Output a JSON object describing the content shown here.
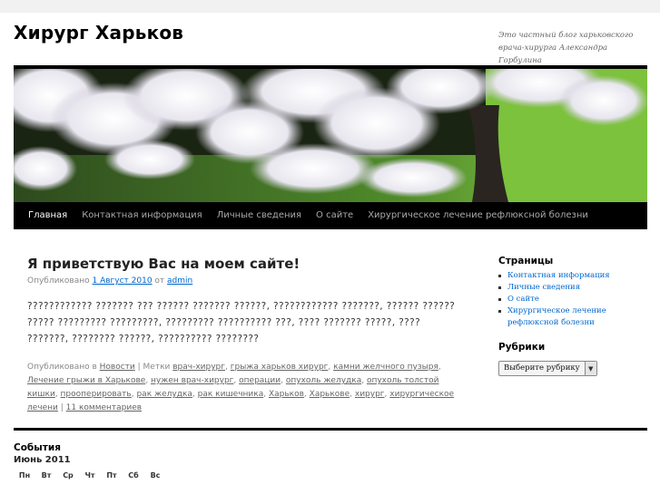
{
  "site": {
    "title": "Хирург Харьков",
    "description": "Это частный блог харьковского врача-хирурга Александра Горбулина"
  },
  "nav": {
    "items": [
      {
        "label": "Главная",
        "active": true
      },
      {
        "label": "Контактная информация"
      },
      {
        "label": "Личные сведения"
      },
      {
        "label": "О сайте"
      },
      {
        "label": "Хирургическое лечение рефлюксной болезни"
      }
    ]
  },
  "post": {
    "title": "Я приветствую  Вас на моем сайте!",
    "meta_prefix": "Опубликовано",
    "date": "1 Август 2010",
    "meta_by": "от",
    "author": "admin",
    "body": "???????????? ??????? ??? ?????? ??????? ??????, ???????????? ???????, ?????? ?????? ????? ????????? ?????????, ????????? ?????????? ???, ???? ??????? ?????, ???? ???????, ???????? ??????, ?????????? ????????",
    "foot_prefix": "Опубликовано в",
    "category": "Новости",
    "tags_prefix": "| Метки",
    "tags": [
      "врач-хирург",
      "грыжа харьков хирург",
      "камни желчного пузыря",
      "Лечение грыжи в Харькове",
      "нужен врач-хирург",
      "операции",
      "опухоль желудка",
      "опухоль толстой кишки",
      "прооперировать",
      "рак желудка",
      "рак кишечника",
      "Харьков",
      "Харькове",
      "хирург",
      "хирургическое лечени"
    ],
    "comments": "11 комментариев"
  },
  "sidebar": {
    "pages_title": "Страницы",
    "pages": [
      "Контактная информация",
      "Личные сведения",
      "О сайте",
      "Хирургическое лечение рефлюксной болезни"
    ],
    "categories_title": "Рубрики",
    "categories_select": "Выберите рубрику"
  },
  "calendar": {
    "title": "События",
    "month": "Июнь 2011",
    "days": [
      "Пн",
      "Вт",
      "Ср",
      "Чт",
      "Пт",
      "Сб",
      "Вс"
    ]
  },
  "colors": {
    "link": "#0066cc",
    "nav_bg": "#000000"
  }
}
